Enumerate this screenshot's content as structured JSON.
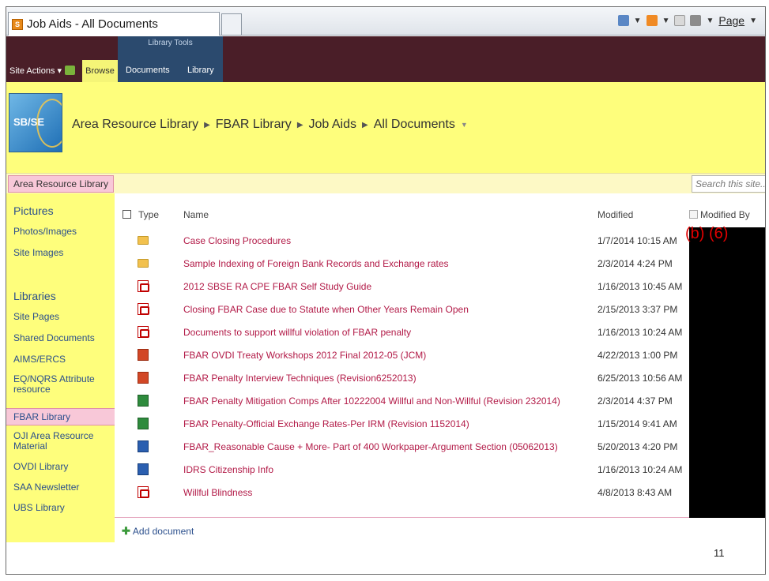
{
  "browser": {
    "tab_title": "Job Aids - All Documents",
    "page_menu": "Page"
  },
  "ribbon": {
    "site_actions": "Site Actions",
    "browse": "Browse",
    "library_tools": "Library Tools",
    "documents": "Documents",
    "library": "Library"
  },
  "header": {
    "logo_text": "SB/SE",
    "breadcrumb": [
      "Area Resource Library",
      "FBAR Library",
      "Job Aids",
      "All Documents"
    ]
  },
  "topbar": {
    "home_link": "Area Resource Library",
    "search_placeholder": "Search this site..."
  },
  "quicklaunch": {
    "pictures_heading": "Pictures",
    "pictures": [
      "Photos/Images",
      "Site Images"
    ],
    "libraries_heading": "Libraries",
    "libraries": [
      "Site Pages",
      "Shared Documents",
      "AIMS/ERCS",
      "EQ/NQRS Attribute resource",
      "FBAR Library",
      "OJI Area Resource Material",
      "OVDI Library",
      "SAA Newsletter",
      "UBS Library"
    ],
    "selected": "FBAR Library"
  },
  "list": {
    "columns": {
      "type": "Type",
      "name": "Name",
      "modified": "Modified",
      "modified_by": "Modified By"
    },
    "rows": [
      {
        "icon": "folder-icon",
        "name": "Case Closing Procedures",
        "modified": "1/7/2014 10:15 AM"
      },
      {
        "icon": "folder-icon",
        "name": "Sample Indexing of Foreign Bank Records and Exchange rates",
        "modified": "2/3/2014 4:24 PM"
      },
      {
        "icon": "pdf-icon",
        "name": "2012 SBSE RA CPE FBAR Self Study Guide",
        "modified": "1/16/2013 10:45 AM"
      },
      {
        "icon": "pdf-icon",
        "name": "Closing FBAR Case due to Statute when Other Years Remain Open",
        "modified": "2/15/2013 3:37 PM"
      },
      {
        "icon": "pdf-icon",
        "name": "Documents to support willful violation of FBAR penalty",
        "modified": "1/16/2013 10:24 AM"
      },
      {
        "icon": "powerpoint-icon",
        "name": "FBAR OVDI Treaty Workshops 2012 Final 2012-05 (JCM)",
        "modified": "4/22/2013 1:00 PM"
      },
      {
        "icon": "powerpoint-icon",
        "name": "FBAR Penalty Interview Techniques (Revision6252013)",
        "modified": "6/25/2013 10:56 AM"
      },
      {
        "icon": "excel-icon",
        "name": "FBAR Penalty Mitigation Comps After 10222004 Willful and Non-Willful (Revision 232014)",
        "modified": "2/3/2014 4:37 PM"
      },
      {
        "icon": "excel-icon",
        "name": "FBAR Penalty-Official Exchange Rates-Per IRM (Revision 1152014)",
        "modified": "1/15/2014 9:41 AM"
      },
      {
        "icon": "word-icon",
        "name": "FBAR_Reasonable Cause + More- Part of 400 Workpaper-Argument Section (05062013)",
        "modified": "5/20/2013 4:20 PM"
      },
      {
        "icon": "word-icon",
        "name": "IDRS Citizenship Info",
        "modified": "1/16/2013 10:24 AM"
      },
      {
        "icon": "pdf-icon",
        "name": "Willful Blindness",
        "modified": "4/8/2013 8:43 AM"
      }
    ],
    "redaction_label": "(b) (6)",
    "add_document": "Add document"
  },
  "slide": {
    "page_number": "11"
  }
}
